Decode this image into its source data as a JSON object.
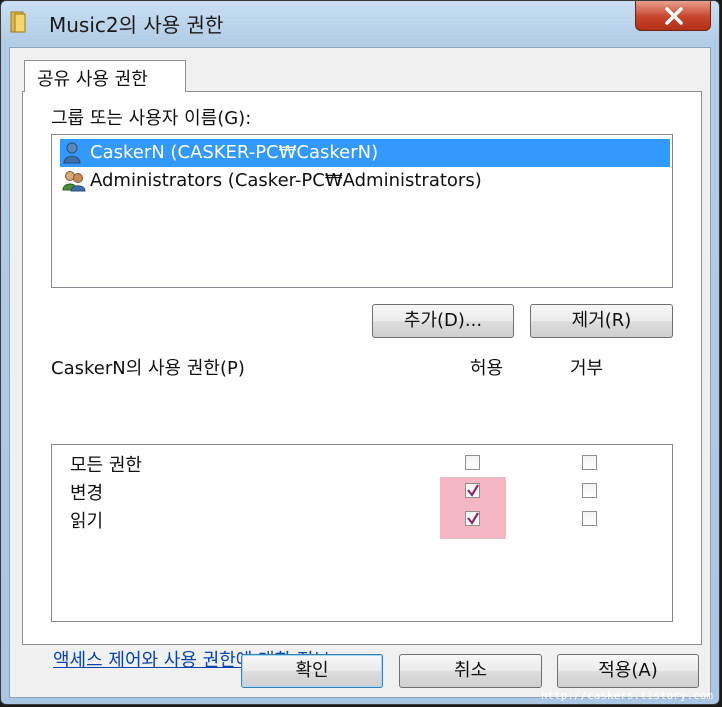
{
  "window": {
    "title": "Music2의 사용 권한",
    "close_label": "×"
  },
  "tab": {
    "label": "공유 사용 권한"
  },
  "groups": {
    "label": "그룹 또는 사용자 이름(G):",
    "items": [
      {
        "name": "CaskerN (CASKER-PC₩CaskerN)",
        "icon": "user-icon",
        "selected": true
      },
      {
        "name": "Administrators (Casker-PC₩Administrators)",
        "icon": "group-icon",
        "selected": false
      }
    ]
  },
  "buttons": {
    "add": "추가(D)...",
    "remove": "제거(R)",
    "ok": "확인",
    "cancel": "취소",
    "apply": "적용(A)"
  },
  "permissions": {
    "label": "CaskerN의 사용 권한(P)",
    "allow_header": "허용",
    "deny_header": "거부",
    "rows": [
      {
        "name": "모든 권한",
        "allow": false,
        "deny": false
      },
      {
        "name": "변경",
        "allow": true,
        "deny": false
      },
      {
        "name": "읽기",
        "allow": true,
        "deny": false
      }
    ],
    "highlight_color": "#f6b7c4"
  },
  "link": {
    "text": "액세스 제어와 사용 권한에 대한 정보"
  },
  "watermark": "http://caskers.tistory.com"
}
